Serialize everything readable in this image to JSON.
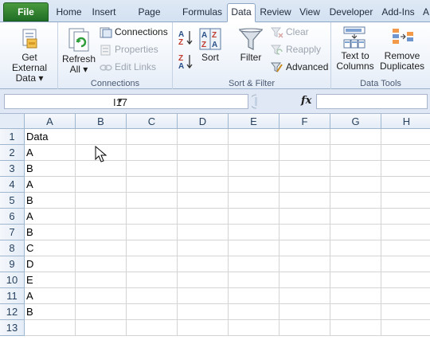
{
  "tabs": [
    "File",
    "Home",
    "Insert",
    "Page Layout",
    "Formulas",
    "Data",
    "Review",
    "View",
    "Developer",
    "Add-Ins",
    "A"
  ],
  "active_tab": "Data",
  "ribbon": {
    "get_external": {
      "line1": "Get External",
      "line2": "Data ▾",
      "group": ""
    },
    "connections_group": {
      "label": "Connections",
      "refresh_line1": "Refresh",
      "refresh_line2": "All ▾",
      "connections": "Connections",
      "properties": "Properties",
      "edit_links": "Edit Links"
    },
    "sort_filter_group": {
      "label": "Sort & Filter",
      "sort": "Sort",
      "filter": "Filter",
      "clear": "Clear",
      "reapply": "Reapply",
      "advanced": "Advanced"
    },
    "data_tools_group": {
      "label": "Data Tools",
      "text_to_columns_l1": "Text to",
      "text_to_columns_l2": "Columns",
      "remove_dup_l1": "Remove",
      "remove_dup_l2": "Duplicates"
    }
  },
  "formula_bar": {
    "name_box": "I17",
    "fx": "fx",
    "formula": ""
  },
  "columns": [
    "A",
    "B",
    "C",
    "D",
    "E",
    "F",
    "G",
    "H"
  ],
  "rows": [
    {
      "n": "1",
      "a": "Data"
    },
    {
      "n": "2",
      "a": "A"
    },
    {
      "n": "3",
      "a": "B"
    },
    {
      "n": "4",
      "a": "A"
    },
    {
      "n": "5",
      "a": "B"
    },
    {
      "n": "6",
      "a": "A"
    },
    {
      "n": "7",
      "a": "B"
    },
    {
      "n": "8",
      "a": "C"
    },
    {
      "n": "9",
      "a": "D"
    },
    {
      "n": "10",
      "a": "E"
    },
    {
      "n": "11",
      "a": "A"
    },
    {
      "n": "12",
      "a": "B"
    },
    {
      "n": "13",
      "a": ""
    }
  ],
  "colors": {
    "file_tab": "#2a7a2e",
    "ribbon_border": "#8ea7c6",
    "header_bg": "#e4ecf7",
    "grid_line": "#d4d4d4"
  },
  "icons": [
    "get-external-data-icon",
    "refresh-all-icon",
    "connections-icon",
    "properties-icon",
    "edit-links-icon",
    "sort-az-icon",
    "sort-za-icon",
    "sort-icon",
    "filter-icon",
    "clear-icon",
    "reapply-icon",
    "advanced-icon",
    "text-to-columns-icon",
    "remove-duplicates-icon",
    "mouse-cursor-icon"
  ]
}
